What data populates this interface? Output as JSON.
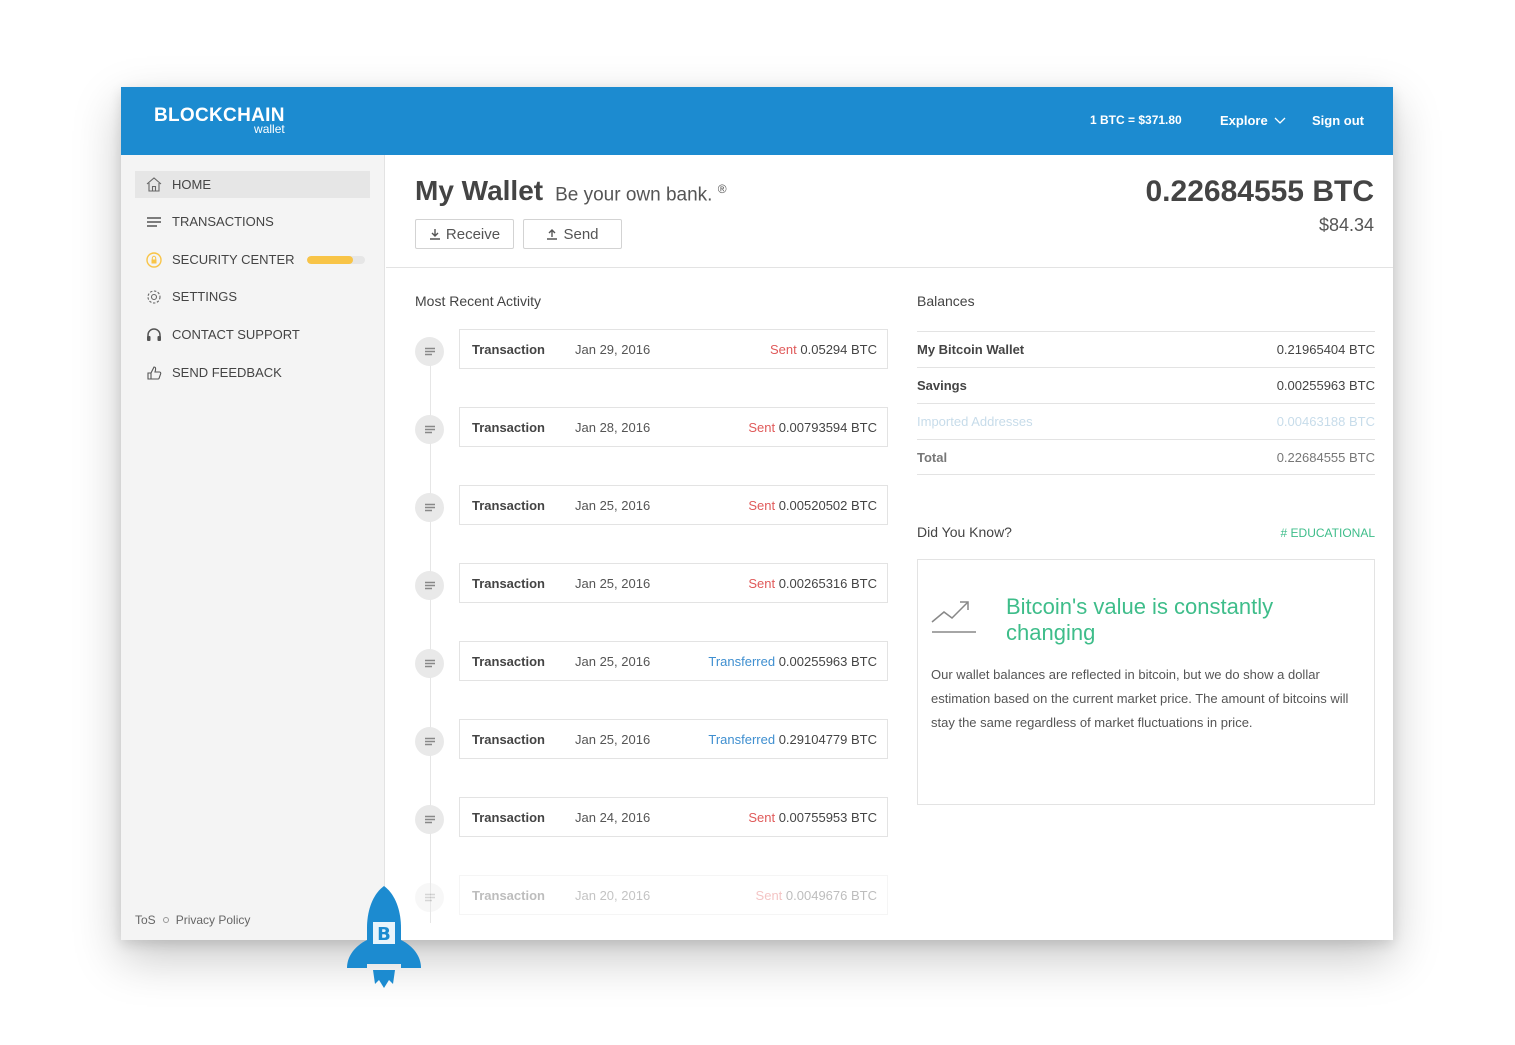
{
  "header": {
    "logo_main": "BLOCKCHAIN",
    "logo_sub": "wallet",
    "rate": "1 BTC = $371.80",
    "explore_label": "Explore",
    "signout_label": "Sign out"
  },
  "sidebar": {
    "items": [
      {
        "label": "HOME",
        "icon": "home-icon"
      },
      {
        "label": "TRANSACTIONS",
        "icon": "list-icon"
      },
      {
        "label": "SECURITY CENTER",
        "icon": "lock-icon",
        "progress": 0.8
      },
      {
        "label": "SETTINGS",
        "icon": "gear-icon"
      },
      {
        "label": "CONTACT SUPPORT",
        "icon": "headset-icon"
      },
      {
        "label": "SEND FEEDBACK",
        "icon": "thumbs-up-icon"
      }
    ],
    "footer": {
      "tos": "ToS",
      "privacy": "Privacy Policy"
    }
  },
  "main": {
    "title": "My Wallet",
    "tagline": "Be your own bank.",
    "tagline_mark": "®",
    "receive_label": "Receive",
    "send_label": "Send",
    "balance_btc": "0.22684555 BTC",
    "balance_usd": "$84.34",
    "activity_heading": "Most Recent Activity",
    "transactions": [
      {
        "label": "Transaction",
        "date": "Jan 29, 2016",
        "type": "Sent",
        "amount": "0.05294 BTC"
      },
      {
        "label": "Transaction",
        "date": "Jan 28, 2016",
        "type": "Sent",
        "amount": "0.00793594 BTC"
      },
      {
        "label": "Transaction",
        "date": "Jan 25, 2016",
        "type": "Sent",
        "amount": "0.00520502 BTC"
      },
      {
        "label": "Transaction",
        "date": "Jan 25, 2016",
        "type": "Sent",
        "amount": "0.00265316 BTC"
      },
      {
        "label": "Transaction",
        "date": "Jan 25, 2016",
        "type": "Transferred",
        "amount": "0.00255963 BTC"
      },
      {
        "label": "Transaction",
        "date": "Jan 25, 2016",
        "type": "Transferred",
        "amount": "0.29104779 BTC"
      },
      {
        "label": "Transaction",
        "date": "Jan 24, 2016",
        "type": "Sent",
        "amount": "0.00755953 BTC"
      },
      {
        "label": "Transaction",
        "date": "Jan 20, 2016",
        "type": "Sent",
        "amount": "0.0049676 BTC"
      }
    ],
    "balances_heading": "Balances",
    "balances": [
      {
        "name": "My Bitcoin Wallet",
        "value": "0.21965404 BTC"
      },
      {
        "name": "Savings",
        "value": "0.00255963 BTC"
      },
      {
        "name": "Imported Addresses",
        "value": "0.00463188 BTC"
      },
      {
        "name": "Total",
        "value": "0.22684555 BTC"
      }
    ],
    "dyk_heading": "Did You Know?",
    "dyk_tag": "# EDUCATIONAL",
    "dyk_title": "Bitcoin's value is constantly changing",
    "dyk_text": "Our wallet balances are reflected in bitcoin, but we do show a dollar estimation based on the current market price. The amount of bitcoins will stay the same regardless of market fluctuations in price."
  },
  "colors": {
    "brand": "#1c8bd0",
    "sent": "#e05a5a",
    "transferred": "#3f8fd0",
    "educational": "#3ebd8a",
    "security_bar": "#f8c447"
  }
}
